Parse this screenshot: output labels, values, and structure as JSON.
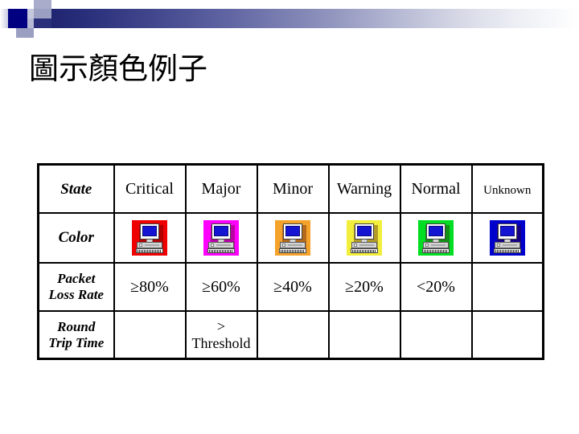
{
  "slide": {
    "title": "圖示顏色例子",
    "banner": {
      "accent_dark": "#000080",
      "gradient_from": "#1b1f6b",
      "gradient_to": "#ffffff"
    }
  },
  "table": {
    "columns": [
      {
        "key": "label",
        "label": ""
      },
      {
        "key": "critical",
        "label": "Critical",
        "size": "normal"
      },
      {
        "key": "major",
        "label": "Major",
        "size": "normal"
      },
      {
        "key": "minor",
        "label": "Minor",
        "size": "normal"
      },
      {
        "key": "warning",
        "label": "Warning",
        "size": "normal"
      },
      {
        "key": "normal",
        "label": "Normal",
        "size": "normal"
      },
      {
        "key": "unknown",
        "label": "Unknown",
        "size": "small"
      }
    ],
    "rows": {
      "state": {
        "label": "State",
        "critical": "Critical",
        "major": "Major",
        "minor": "Minor",
        "warning": "Warning",
        "normal": "Normal",
        "unknown": "Unknown"
      },
      "color": {
        "label": "Color",
        "icon_name": "computer-icon",
        "swatches": [
          {
            "state": "Critical",
            "color": "#ee0000"
          },
          {
            "state": "Major",
            "color": "#ff00ff"
          },
          {
            "state": "Minor",
            "color": "#f5a22a"
          },
          {
            "state": "Warning",
            "color": "#f2ee3c"
          },
          {
            "state": "Normal",
            "color": "#00dd22"
          },
          {
            "state": "Unknown",
            "color": "#0000cc"
          }
        ]
      },
      "packet_loss_rate": {
        "label_line1": "Packet",
        "label_line2": "Loss Rate",
        "critical": "≥80%",
        "major": "≥60%",
        "minor": "≥40%",
        "warning": "≥20%",
        "normal": "<20%",
        "unknown": ""
      },
      "round_trip_time": {
        "label_line1": "Round",
        "label_line2": "Trip Time",
        "critical": "",
        "major_line1": ">",
        "major_line2": "Threshold",
        "minor": "",
        "warning": "",
        "normal": "",
        "unknown": ""
      }
    }
  }
}
